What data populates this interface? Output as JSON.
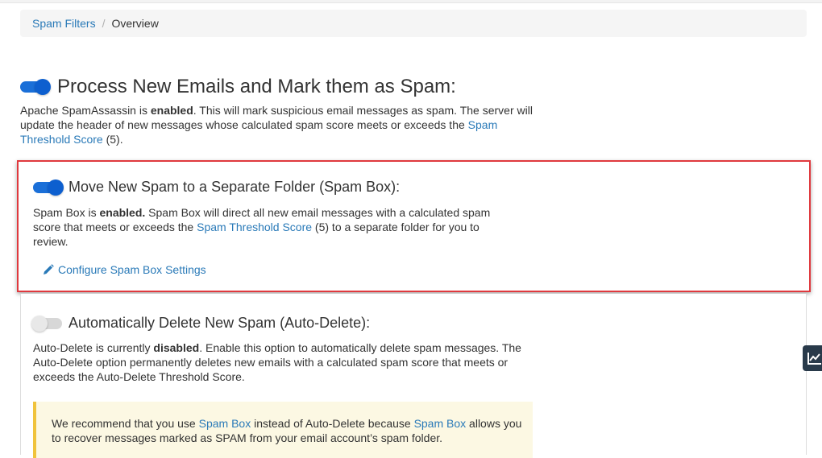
{
  "breadcrumb": {
    "parent": "Spam Filters",
    "separator": "/",
    "current": "Overview"
  },
  "process": {
    "title": "Process New Emails and Mark them as Spam:",
    "toggle_on": true,
    "desc_prefix": "Apache SpamAssassin is ",
    "desc_status": "enabled",
    "desc_middle": ". This will mark suspicious email messages as spam. The server will update the header of new messages whose calculated spam score meets or exceeds the ",
    "desc_link": "Spam Threshold Score",
    "desc_suffix": " (5)."
  },
  "spambox": {
    "title": "Move New Spam to a Separate Folder (Spam Box):",
    "toggle_on": true,
    "desc_prefix": "Spam Box is ",
    "desc_status": "enabled.",
    "desc_middle": " Spam Box will direct all new email messages with a calculated spam score that meets or exceeds the ",
    "desc_link": "Spam Threshold Score",
    "desc_suffix": " (5) to a separate folder for you to review.",
    "configure_label": "Configure Spam Box Settings"
  },
  "autodelete": {
    "title": "Automatically Delete New Spam (Auto-Delete):",
    "toggle_on": false,
    "desc_prefix": "Auto-Delete is currently ",
    "desc_status": "disabled",
    "desc_suffix": ". Enable this option to automatically delete spam messages. The Auto-Delete option permanently deletes new emails with a calculated spam score that meets or exceeds the Auto-Delete Threshold Score."
  },
  "alert": {
    "prefix": "We recommend that you use ",
    "link1": "Spam Box",
    "middle": " instead of Auto-Delete because ",
    "link2": "Spam Box",
    "suffix": " allows you to recover messages marked as SPAM from your email account’s spam folder."
  },
  "colors": {
    "link": "#2a7ab8",
    "toggle_on": "#1a6fd8",
    "highlight_border": "#e0393e",
    "alert_bg": "#fcf8e3"
  },
  "icons": {
    "configure": "pencil-icon",
    "side_widget": "chart-icon"
  }
}
